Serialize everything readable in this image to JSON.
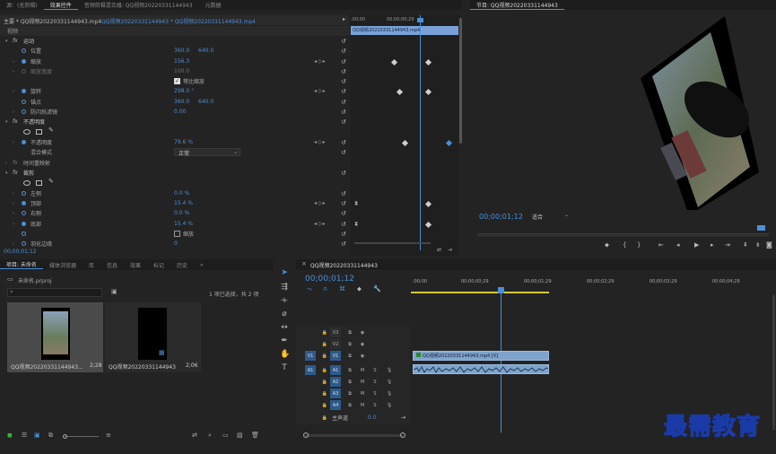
{
  "effect_controls": {
    "tabs": [
      "源：(无剪辑)",
      "效果控件",
      "音频剪辑混合器: QQ视频20220331144943",
      "元数据"
    ],
    "main_label": "主要 * QQ视频20220331144943.mp4",
    "sequence_label": "QQ视频20220331144943 * QQ视频20220331144943.mp4",
    "section_video": "视频",
    "times": [
      ":00;00",
      "00;00;00;29",
      "00;00;01;29"
    ],
    "clip_label": "QQ视频20220331144943.mp4",
    "motion": "运动",
    "position": {
      "label": "位置",
      "x": "360.0",
      "y": "640.0"
    },
    "scale": {
      "label": "缩放",
      "value": "156.3"
    },
    "scale_width": {
      "label": "缩放宽度",
      "value": "100.0"
    },
    "uniform_scale": "等比缩放",
    "rotation": {
      "label": "旋转",
      "value": "298.0 °"
    },
    "anchor": {
      "label": "锚点",
      "x": "360.0",
      "y": "640.0"
    },
    "anti_flicker": {
      "label": "防闪烁滤镜",
      "value": "0.00"
    },
    "opacity_group": "不透明度",
    "opacity": {
      "label": "不透明度",
      "value": "79.6 %"
    },
    "blend_mode": {
      "label": "混合模式",
      "value": "正常"
    },
    "time_remap": "时间重映射",
    "crop": "裁剪",
    "crop_left": {
      "label": "左侧",
      "value": "0.0 %"
    },
    "crop_top": {
      "label": "顶部",
      "value": "15.4 %"
    },
    "crop_right": {
      "label": "右侧",
      "value": "0.0 %"
    },
    "crop_bottom": {
      "label": "底部",
      "value": "15.4 %"
    },
    "zoom_label": "缩放",
    "feather": {
      "label": "羽化边缘",
      "value": "0"
    },
    "timecode": "00;00;01;12"
  },
  "program": {
    "title": "节目: QQ视频20220331144943",
    "timecode": "00;00;01;12",
    "fit": "适合"
  },
  "project": {
    "tabs": [
      "项目: 未命名",
      "媒体浏览器",
      "库",
      "信息",
      "效果",
      "标记",
      "历史"
    ],
    "file": "未命名.prproj",
    "selection": "1 项已选择，共 2 项",
    "items": [
      {
        "name": "QQ视频20220331144943...",
        "duration": "2;28"
      },
      {
        "name": "QQ视频20220331144943",
        "duration": "2;06"
      }
    ]
  },
  "timeline": {
    "title": "QQ视频20220331144943",
    "timecode": "00;00;01;12",
    "ruler": [
      ":00;00",
      "00;00;00;29",
      "00;00;01;29",
      "00;00;02;29",
      "00;00;03;29",
      "00;00;04;29"
    ],
    "video_tracks": [
      "V3",
      "V2",
      "V1"
    ],
    "audio_tracks": [
      "A1",
      "A2",
      "A3",
      "A4"
    ],
    "master": {
      "label": "主声道",
      "value": "0.0"
    },
    "clip_label": "QQ视频20220331144943.mp4 [V]",
    "source_v": "V1",
    "source_a": "A1",
    "m": "M",
    "s": "S"
  },
  "watermark": "最需教育"
}
